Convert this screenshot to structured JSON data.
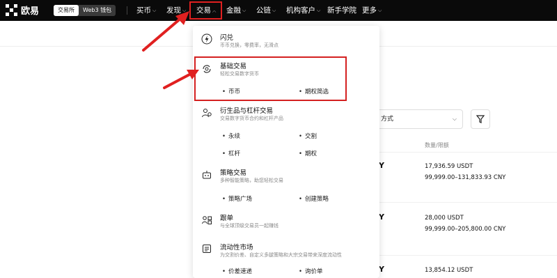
{
  "topbar": {
    "brand": "欧易",
    "switch": {
      "exchange": "交易所",
      "wallet": "Web3 钱包"
    },
    "nav": [
      {
        "label": "买币"
      },
      {
        "label": "发现"
      },
      {
        "label": "交易"
      },
      {
        "label": "金融"
      },
      {
        "label": "公链"
      },
      {
        "label": "机构客户"
      },
      {
        "label": "新手学院"
      },
      {
        "label": "更多"
      }
    ]
  },
  "dropdown": {
    "flash": {
      "title": "闪兑",
      "desc": "币币兑换，零费率，无滑点"
    },
    "basic": {
      "title": "基础交易",
      "desc": "轻松交易数字货币",
      "items": [
        "币币",
        "期权简选"
      ]
    },
    "deriv": {
      "title": "衍生品与杠杆交易",
      "desc": "交易数字货币合约和杠杆产品",
      "items": [
        "永续",
        "交割",
        "杠杆",
        "期权"
      ]
    },
    "strategy": {
      "title": "策略交易",
      "desc": "多种智能策略，助您轻松交易",
      "items": [
        "策略广场",
        "创建策略"
      ]
    },
    "copy": {
      "title": "跟单",
      "desc": "与全球顶级交易员一起赚钱"
    },
    "liquidity": {
      "title": "流动性市场",
      "desc": "为交割价差、自定义多腿策略和大宗交易带来深度流动性",
      "items": [
        "价差速递",
        "询价单"
      ]
    }
  },
  "background": {
    "select_text": "方式",
    "col_head": "数量/限额",
    "rows": [
      {
        "currency": "Y",
        "amount": "17,936.59 USDT",
        "limit": "99,999.00–131,833.93 CNY"
      },
      {
        "currency": "Y",
        "amount": "28,000 USDT",
        "limit": "99,999.00–205,800.00 CNY"
      },
      {
        "currency": "Y",
        "amount": "13,854.12 USDT",
        "limit": ""
      }
    ]
  },
  "colors": {
    "highlight": "#d42020",
    "topbar": "#0a0a0a"
  }
}
